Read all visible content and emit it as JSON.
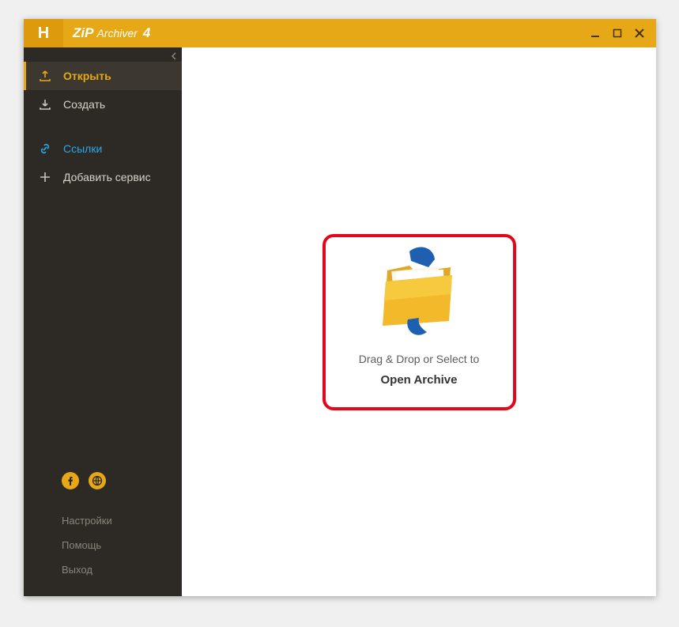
{
  "app": {
    "logo_letter": "H",
    "title_zip": "ZiP",
    "title_archiver": "Archiver",
    "title_version": "4"
  },
  "sidebar": {
    "open_label": "Открыть",
    "create_label": "Создать",
    "links_label": "Ссылки",
    "add_service_label": "Добавить сервис",
    "settings_label": "Настройки",
    "help_label": "Помощь",
    "exit_label": "Выход"
  },
  "main": {
    "drag_text": "Drag & Drop or Select to",
    "open_archive": "Open Archive"
  }
}
